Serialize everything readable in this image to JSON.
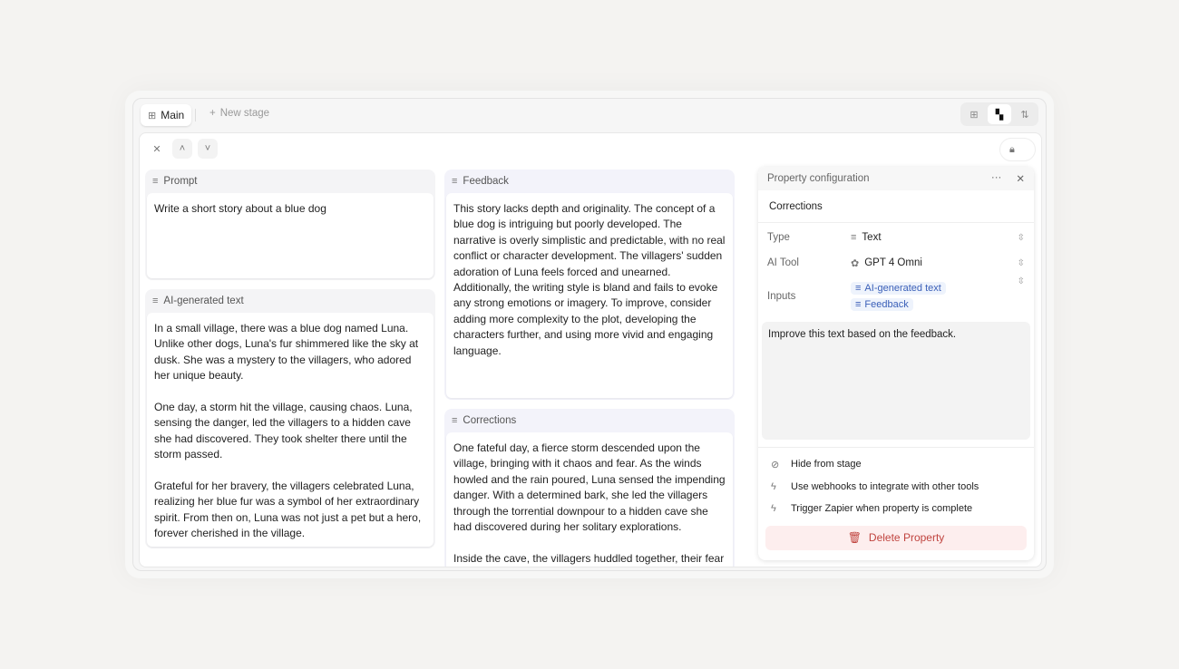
{
  "tabs": {
    "main": "Main",
    "new_stage": "New stage"
  },
  "cards": {
    "prompt": {
      "label": "Prompt",
      "text": "Write a short story about a blue dog"
    },
    "ai": {
      "label": "AI-generated text",
      "text": "In a small village, there was a blue dog named Luna. Unlike other dogs, Luna's fur shimmered like the sky at dusk. She was a mystery to the villagers, who adored her unique beauty.\n\nOne day, a storm hit the village, causing chaos. Luna, sensing the danger, led the villagers to a hidden cave she had discovered. They took shelter there until the storm passed.\n\nGrateful for her bravery, the villagers celebrated Luna, realizing her blue fur was a symbol of her extraordinary spirit. From then on, Luna was not just a pet but a hero, forever cherished in the village."
    },
    "feedback": {
      "label": "Feedback",
      "text": "This story lacks depth and originality. The concept of a blue dog is intriguing but poorly developed. The narrative is overly simplistic and predictable, with no real conflict or character development. The villagers' sudden adoration of Luna feels forced and unearned. Additionally, the writing style is bland and fails to evoke any strong emotions or imagery. To improve, consider adding more complexity to the plot, developing the characters further, and using more vivid and engaging language."
    },
    "corrections": {
      "label": "Corrections",
      "text": "One fateful day, a fierce storm descended upon the village, bringing with it chaos and fear. As the winds howled and the rain poured, Luna sensed the impending danger. With a determined bark, she led the villagers through the torrential downpour to a hidden cave she had discovered during her solitary explorations.\n\nInside the cave, the villagers huddled together, their fear"
    }
  },
  "config": {
    "title": "Property configuration",
    "name": "Corrections",
    "type_label": "Type",
    "type_value": "Text",
    "tool_label": "AI Tool",
    "tool_value": "GPT 4 Omni",
    "inputs_label": "Inputs",
    "inputs": [
      "AI-generated text",
      "Feedback"
    ],
    "prompt": "Improve this text based on the feedback.",
    "options": [
      "Hide from stage",
      "Use webhooks to integrate with other tools",
      "Trigger Zapier when property is complete"
    ],
    "delete": "Delete Property"
  },
  "colors": {
    "accent": "#3a5fb8",
    "danger": "#c0443f"
  }
}
